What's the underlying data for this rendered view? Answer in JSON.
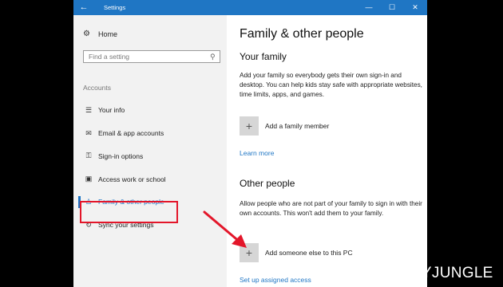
{
  "window": {
    "title": "Settings",
    "back_icon": "←",
    "minimize_icon": "—",
    "maximize_icon": "☐",
    "close_icon": "✕"
  },
  "sidebar": {
    "home_label": "Home",
    "home_icon": "⚙",
    "search_placeholder": "Find a setting",
    "search_icon": "⚲",
    "section_label": "Accounts",
    "items": [
      {
        "label": "Your info",
        "icon": "☰",
        "icon_name": "person-card-icon"
      },
      {
        "label": "Email & app accounts",
        "icon": "✉",
        "icon_name": "mail-icon"
      },
      {
        "label": "Sign-in options",
        "icon": "⚿",
        "icon_name": "key-icon"
      },
      {
        "label": "Access work or school",
        "icon": "▣",
        "icon_name": "briefcase-icon"
      },
      {
        "label": "Family & other people",
        "icon": "♙",
        "icon_name": "person-icon",
        "active": true
      },
      {
        "label": "Sync your settings",
        "icon": "↻",
        "icon_name": "sync-icon"
      }
    ]
  },
  "main": {
    "title": "Family & other people",
    "family": {
      "heading": "Your family",
      "description": "Add your family so everybody gets their own sign-in and desktop. You can help kids stay safe with appropriate websites, time limits, apps, and games.",
      "add_label": "Add a family member",
      "learn_more": "Learn more"
    },
    "other": {
      "heading": "Other people",
      "description": "Allow people who are not part of your family to sign in with their own accounts. This won't add them to your family.",
      "add_label": "Add someone else to this PC",
      "assigned_access": "Set up assigned access"
    },
    "plus_icon": "+"
  },
  "watermark": "TECHYJUNGLE",
  "colors": {
    "accent": "#1f76c4",
    "highlight": "#e3162a",
    "sidebar_bg": "#f2f2f2"
  }
}
